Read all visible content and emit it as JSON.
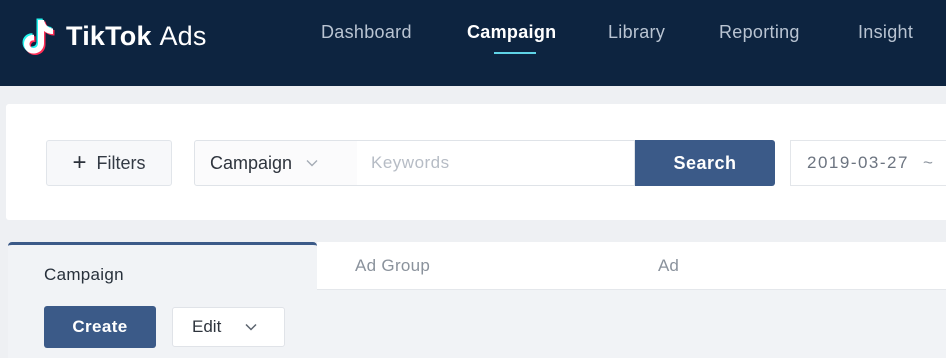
{
  "brand": {
    "logo_text": "TikTok",
    "logo_suffix": "Ads",
    "accent_color": "#5fd3e6",
    "nav_bg": "#0d2440",
    "primary_button_color": "#3b5a88"
  },
  "nav": {
    "items": [
      {
        "label": "Dashboard",
        "active": false
      },
      {
        "label": "Campaign",
        "active": true
      },
      {
        "label": "Library",
        "active": false
      },
      {
        "label": "Reporting",
        "active": false
      },
      {
        "label": "Insight",
        "active": false
      }
    ]
  },
  "search": {
    "filters_label": "Filters",
    "scope_value": "Campaign",
    "keyword_placeholder": "Keywords",
    "keyword_value": "",
    "search_label": "Search",
    "date_start": "2019-03-27",
    "date_separator": "~"
  },
  "tabs": {
    "items": [
      {
        "label": "Campaign",
        "active": true
      },
      {
        "label": "Ad Group",
        "active": false
      },
      {
        "label": "Ad",
        "active": false
      }
    ]
  },
  "actions": {
    "create_label": "Create",
    "edit_label": "Edit"
  },
  "icons": {
    "logo": "tiktok-note-icon",
    "filters": "plus-icon",
    "dropdown": "chevron-down-icon"
  }
}
